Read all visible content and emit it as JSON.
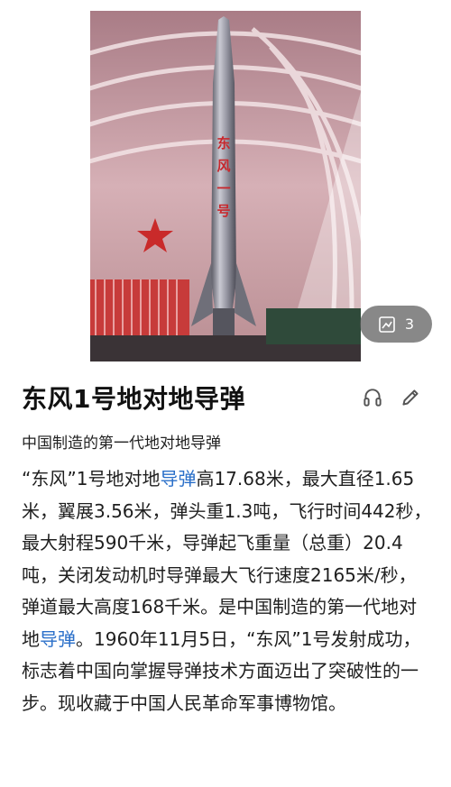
{
  "media": {
    "image_alt_icon": "rocket-photo",
    "image_count": "3",
    "gallery_icon": "gallery-icon",
    "rocket_text": "东风一号"
  },
  "article": {
    "title": "东风1号地对地导弹",
    "subtitle": "中国制造的第一代地对地导弹",
    "icons": {
      "listen": "headphones-icon",
      "edit": "pencil-icon"
    },
    "body": {
      "p1": "“东风”1号地对地",
      "link1": "导弹",
      "p2": "高17.68米，最大直径1.65米，翼展3.56米，弹头重1.3吨，飞行时间442秒，最大射程590千米，导弹起飞重量（总重）20.4吨，关闭发动机时导弹最大飞行速度2165米/秒，弹道最大高度168千米。是中国制造的第一代地对地",
      "link2": "导弹",
      "p3": "。1960年11月5日，“东风”1号发射成功，标志着中国向掌握导弹技术方面迈出了突破性的一步。现收藏于中国人民革命军事博物馆。"
    }
  },
  "colors": {
    "link": "#2a6fc9",
    "badge_bg": "#5a5a5a",
    "rocket_text": "#c8282d"
  }
}
